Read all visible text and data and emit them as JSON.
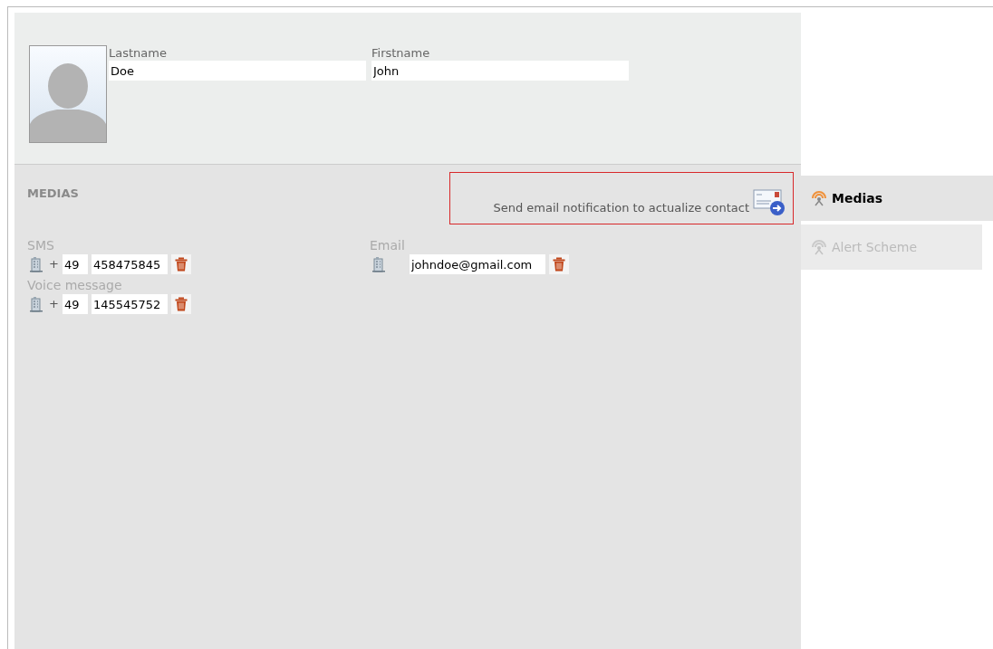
{
  "contact": {
    "fields": [
      {
        "label": "Lastname",
        "value": "Doe"
      },
      {
        "label": "Firstname",
        "value": "John"
      }
    ]
  },
  "medias": {
    "title": "MEDIAS",
    "notify_button": "Send email notification to actualize contact",
    "columns": [
      [
        {
          "kind": "phone",
          "label": "SMS",
          "plus": "+",
          "country": "49",
          "number": "458475845"
        },
        {
          "kind": "phone",
          "label": "Voice message",
          "plus": "+",
          "country": "49",
          "number": "145545752"
        }
      ],
      [
        {
          "kind": "email",
          "label": "Email",
          "address": "johndoe@gmail.com"
        }
      ]
    ]
  },
  "tabs": [
    {
      "label": "Medias",
      "selected": true
    },
    {
      "label": "Alert Scheme",
      "selected": false
    }
  ]
}
